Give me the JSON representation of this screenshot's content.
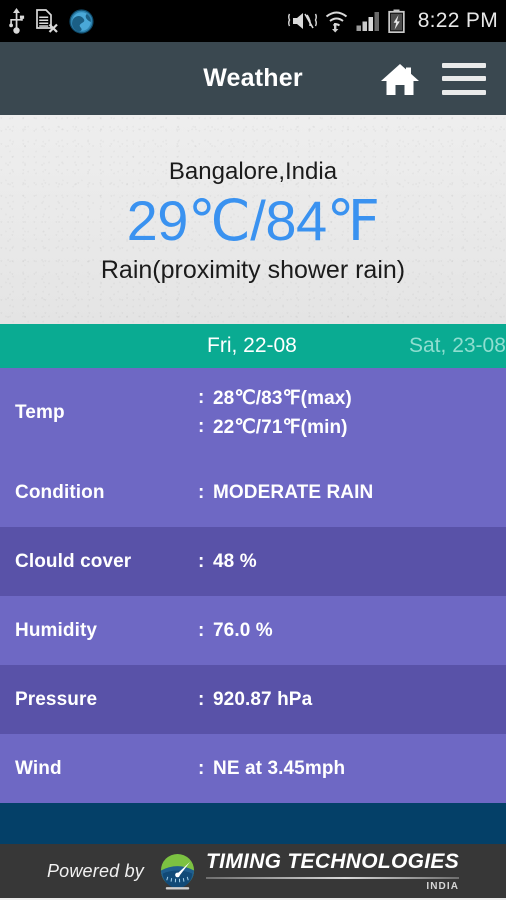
{
  "statusbar": {
    "time": "8:22 PM",
    "left_icons": [
      "usb-icon",
      "sim-card-missing-icon",
      "browser-globe-icon"
    ],
    "right_icons": [
      "mute-vibrate-icon",
      "wifi-icon",
      "cellular-signal-icon",
      "battery-charging-icon"
    ]
  },
  "appbar": {
    "title": "Weather",
    "home_label": "Home",
    "menu_label": "Menu"
  },
  "current": {
    "location": "Bangalore,India",
    "temperature": "29℃/84℉",
    "description": "Rain(proximity shower rain)",
    "temp_color": "#3a92f0"
  },
  "tabs": {
    "accent_color": "#0aab92",
    "items": [
      {
        "label": "Fri, 22-08",
        "active": true
      },
      {
        "label": "Sat, 23-08",
        "active": false
      }
    ]
  },
  "details": {
    "row_color_dark": "#5952a8",
    "row_color_light": "#6e68c4",
    "separator": ":",
    "rows": [
      {
        "label": "Temp",
        "values": [
          "28℃/83℉(max)",
          "22℃/71℉(min)"
        ]
      },
      {
        "label": "Condition",
        "values": [
          "MODERATE RAIN"
        ]
      },
      {
        "label": "Clould cover",
        "values": [
          "48 %"
        ]
      },
      {
        "label": "Humidity",
        "values": [
          "76.0 %"
        ]
      },
      {
        "label": "Pressure",
        "values": [
          "920.87 hPa"
        ]
      },
      {
        "label": "Wind",
        "values": [
          "NE at 3.45mph"
        ]
      }
    ]
  },
  "footer": {
    "powered_by": "Powered by",
    "brand_name": "TIMING TECHNOLOGIES",
    "brand_sub": "INDIA",
    "strip_color": "#044068",
    "bar_color": "#373737"
  }
}
